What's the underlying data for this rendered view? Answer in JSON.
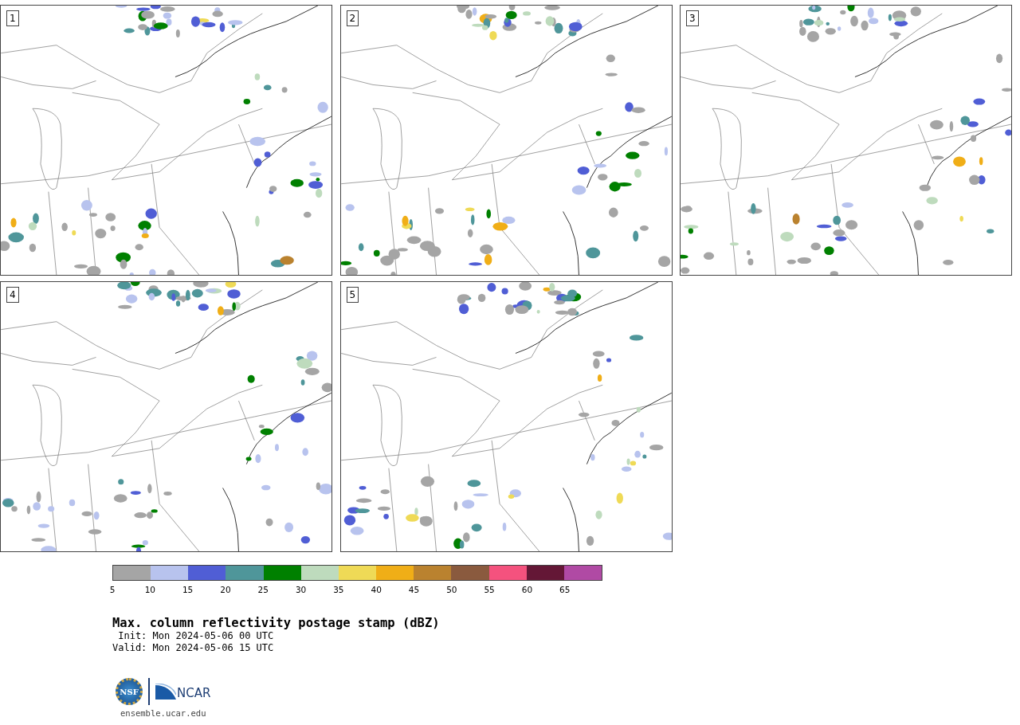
{
  "panels": [
    {
      "label": "1"
    },
    {
      "label": "2"
    },
    {
      "label": "3"
    },
    {
      "label": "4"
    },
    {
      "label": "5"
    }
  ],
  "colorbar": {
    "bins": [
      {
        "color": "#a5a5a5"
      },
      {
        "color": "#b8c3ee"
      },
      {
        "color": "#505ed5"
      },
      {
        "color": "#4f969a"
      },
      {
        "color": "#008000"
      },
      {
        "color": "#bedbbd"
      },
      {
        "color": "#efda56"
      },
      {
        "color": "#f0ae17"
      },
      {
        "color": "#ba822f"
      },
      {
        "color": "#8a5a3e"
      },
      {
        "color": "#f4527e"
      },
      {
        "color": "#641736"
      },
      {
        "color": "#b04aa4"
      }
    ],
    "tick_labels": [
      "5",
      "10",
      "15",
      "20",
      "25",
      "30",
      "35",
      "40",
      "45",
      "50",
      "55",
      "60",
      "65"
    ]
  },
  "title": "Max. column reflectivity postage stamp (dBZ)",
  "init": " Init: Mon 2024-05-06 00 UTC",
  "valid": "Valid: Mon 2024-05-06 15 UTC",
  "logo": {
    "seal_text": "NSF",
    "wordmark": "NCAR"
  },
  "site": "ensemble.ucar.edu"
}
